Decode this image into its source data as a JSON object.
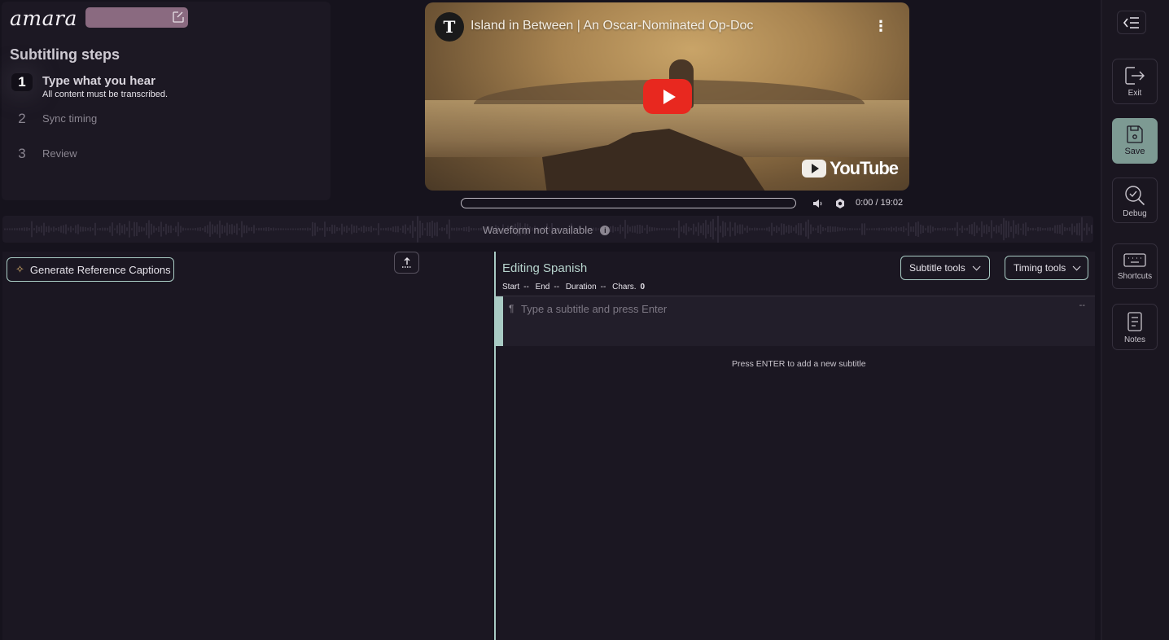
{
  "app": {
    "logo": "amara",
    "title_field_value": ""
  },
  "steps": {
    "heading": "Subtitling steps",
    "items": [
      {
        "number": "1",
        "label": "Type what you hear",
        "subtitle": "All content must be transcribed.",
        "active": true
      },
      {
        "number": "2",
        "label": "Sync timing",
        "active": false
      },
      {
        "number": "3",
        "label": "Review",
        "active": false
      }
    ]
  },
  "video": {
    "title": "Island in Between | An Oscar-Nominated Op-Doc",
    "channel_icon": "T",
    "platform": "YouTube",
    "progress": 0,
    "time": "0:00 / 19:02"
  },
  "waveform": {
    "message": "Waveform not available"
  },
  "reference": {
    "generate_label": "Generate Reference Captions"
  },
  "editor": {
    "title": "Editing Spanish",
    "meta": {
      "start_label": "Start",
      "start_value": "--",
      "end_label": "End",
      "end_value": "--",
      "duration_label": "Duration",
      "duration_value": "--",
      "chars_label": "Chars.",
      "chars_value": "0"
    },
    "subtitle_tools_label": "Subtitle tools",
    "timing_tools_label": "Timing tools",
    "row": {
      "placeholder": "Type a subtitle and press Enter",
      "value": "",
      "duration": "--"
    },
    "hint": "Press ENTER to add a new subtitle"
  },
  "sidebar": {
    "items": [
      {
        "label": "Exit",
        "icon": "exit-icon"
      },
      {
        "label": "Save",
        "icon": "save-icon"
      },
      {
        "label": "Debug",
        "icon": "debug-icon"
      },
      {
        "label": "Shortcuts",
        "icon": "keyboard-icon"
      },
      {
        "label": "Notes",
        "icon": "notes-icon"
      }
    ]
  },
  "colors": {
    "accent": "#a9cbc4",
    "save_bg": "#7d9a93",
    "title_field": "#8a6a80",
    "play_button": "#e8281f"
  }
}
